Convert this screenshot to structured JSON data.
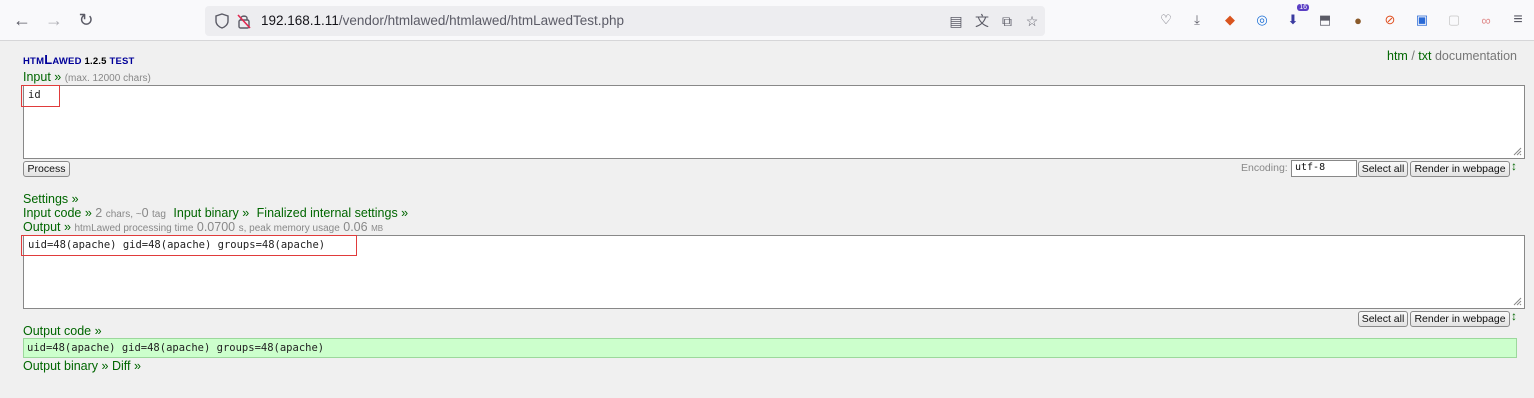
{
  "browser": {
    "url_host": "192.168.1.11",
    "url_path": "/vendor/htmlawed/htmlawed/htmLawedTest.php",
    "ext_badge": "16"
  },
  "header": {
    "logo_prefix": "htm",
    "logo_l": "L",
    "logo_suffix": "awed",
    "version": "1.2.5",
    "test": "test",
    "link_htm": "htm",
    "sep": "/",
    "link_txt": "txt",
    "documentation": "documentation"
  },
  "input": {
    "label": "Input »",
    "note": "(max. 12000 chars)",
    "value": "id",
    "process_button": "Process",
    "encoding_label": "Encoding:",
    "encoding_value": "utf-8",
    "select_all": "Select all",
    "render": "Render in webpage"
  },
  "links": {
    "settings": "Settings »",
    "input_code": "Input code »",
    "input_code_stats_a": "2",
    "input_code_stats_b": "chars, ~",
    "input_code_stats_c": "0",
    "input_code_stats_d": "tag",
    "input_binary": "Input binary »",
    "finalized": "Finalized internal settings »"
  },
  "output": {
    "label": "Output »",
    "timing_a": "htmLawed processing time",
    "time": "0.0700",
    "timing_b": "s, peak memory usage",
    "memory": "0.06",
    "timing_c": "MB",
    "value": "uid=48(apache) gid=48(apache) groups=48(apache)",
    "select_all": "Select all",
    "render": "Render in webpage"
  },
  "output_code": {
    "label": "Output code »",
    "value": "uid=48(apache) gid=48(apache) groups=48(apache)",
    "binary": "Output binary »",
    "diff": "Diff »"
  }
}
